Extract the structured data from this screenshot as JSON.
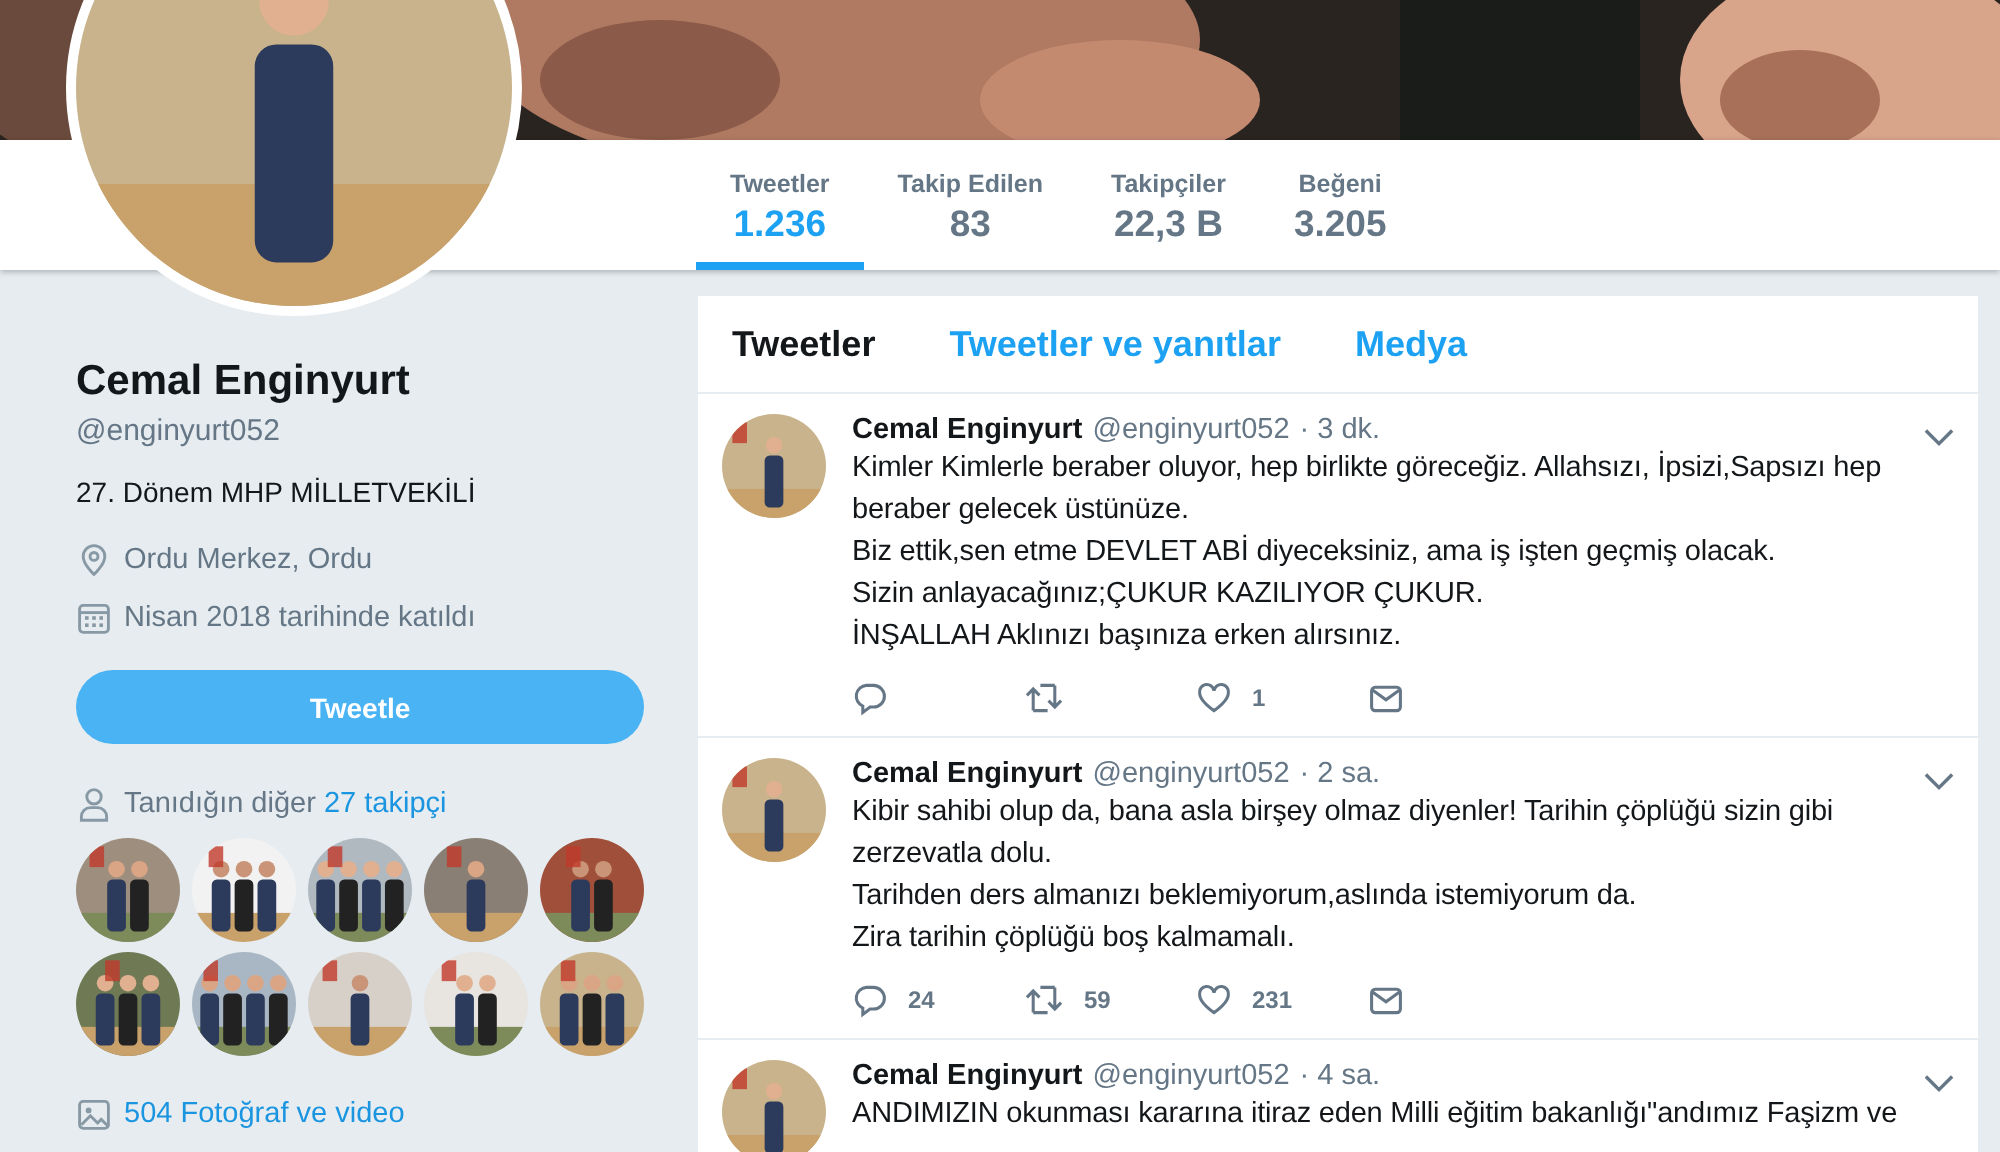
{
  "stats": [
    {
      "label": "Tweetler",
      "value": "1.236",
      "selected": true
    },
    {
      "label": "Takip Edilen",
      "value": "83",
      "selected": false
    },
    {
      "label": "Takipçiler",
      "value": "22,3 B",
      "selected": false
    },
    {
      "label": "Beğeni",
      "value": "3.205",
      "selected": false
    }
  ],
  "profile": {
    "name": "Cemal Enginyurt",
    "handle": "@enginyurt052",
    "bio": "27. Dönem MHP MİLLETVEKİLİ",
    "location": "Ordu Merkez, Ordu",
    "joined": "Nisan 2018 tarihinde katıldı",
    "tweet_button": "Tweetle",
    "followers_you_know": {
      "text": "Tanıdığın diğer ",
      "link": "27 takipçi"
    },
    "photos_link": "504 Fotoğraf ve video"
  },
  "timeline_tabs": [
    {
      "label": "Tweetler",
      "selected": true
    },
    {
      "label": "Tweetler ve yanıtlar",
      "selected": false
    },
    {
      "label": "Medya",
      "selected": false
    }
  ],
  "tweets": [
    {
      "name": "Cemal Enginyurt",
      "handle": "@enginyurt052",
      "time": "· 3 dk.",
      "text": "Kimler Kimlerle beraber oluyor, hep birlikte göreceğiz. Allahsızı, İpsizi,Sapsızı hep beraber gelecek üstünüze.\nBiz ettik,sen etme DEVLET ABİ diyeceksiniz, ama iş işten geçmiş olacak.\nSizin anlayacağınız;ÇUKUR KAZILIYOR ÇUKUR.\nİNŞALLAH Aklınızı başınıza erken alırsınız.",
      "likes": "1"
    },
    {
      "name": "Cemal Enginyurt",
      "handle": "@enginyurt052",
      "time": "· 2 sa.",
      "text": "Kibir sahibi olup da, bana asla birşey olmaz diyenler! Tarihin çöplüğü sizin gibi zerzevatla dolu.\nTarihden ders almanızı beklemiyorum,aslında istemiyorum da.\nZira tarihin çöplüğü boş kalmamalı.",
      "replies": "24",
      "retweets": "59",
      "likes": "231"
    },
    {
      "name": "Cemal Enginyurt",
      "handle": "@enginyurt052",
      "time": "· 4 sa.",
      "text": "ANDIMIZIN okunması kararına itiraz eden Milli eğitim bakanlığı\"andımız Faşizm ve"
    }
  ]
}
